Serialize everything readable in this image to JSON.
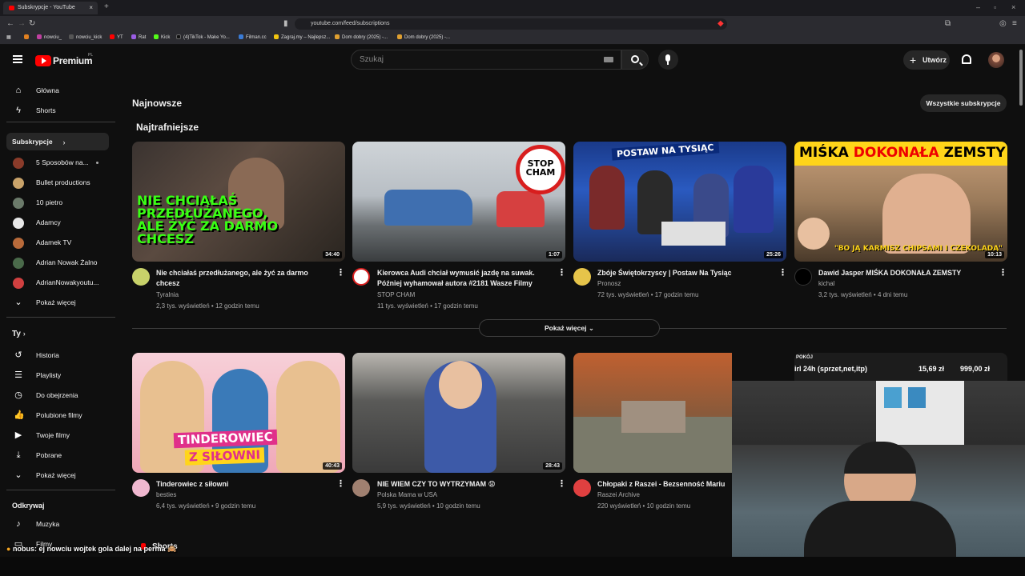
{
  "browser": {
    "tab_title": "Subskrypcje - YouTube",
    "url": "youtube.com/feed/subscriptions",
    "bookmarks": [
      "nowciu_",
      "nowciu_kick",
      "YT",
      "Rat",
      "Kick",
      "(4)TikTok - Make Yo...",
      "Filman.cc",
      "Zagraj.my – Najlepsz...",
      "Dom dobry (2025) -...",
      "Dom dobry (2025) -..."
    ]
  },
  "masthead": {
    "logo": "Premium",
    "logo_region": "PL",
    "search_placeholder": "Szukaj",
    "create_label": "Utwórz"
  },
  "sidebar": {
    "main": [
      {
        "label": "Główna",
        "icon": "home-icon"
      },
      {
        "label": "Shorts",
        "icon": "shorts-icon"
      }
    ],
    "subscriptions_header": "Subskrypcje",
    "subscriptions": [
      {
        "label": "5 Sposobów na...",
        "color": "#8a3b2a",
        "new": true
      },
      {
        "label": "Bullet productions",
        "color": "#c9a36a"
      },
      {
        "label": "10 pietro",
        "color": "#6b7a6a"
      },
      {
        "label": "Adamcy",
        "color": "#e8e8e8"
      },
      {
        "label": "Adamek TV",
        "color": "#b86a3a"
      },
      {
        "label": "Adrian Nowak Żalno",
        "color": "#4a6a4a"
      },
      {
        "label": "AdrianNowakyoutu...",
        "color": "#d04040"
      }
    ],
    "show_more": "Pokaż więcej",
    "you_header": "Ty",
    "you_items": [
      {
        "label": "Historia",
        "icon": "history-icon"
      },
      {
        "label": "Playlisty",
        "icon": "playlist-icon"
      },
      {
        "label": "Do obejrzenia",
        "icon": "watch-later-icon"
      },
      {
        "label": "Polubione filmy",
        "icon": "like-icon"
      },
      {
        "label": "Twoje filmy",
        "icon": "your-videos-icon"
      },
      {
        "label": "Pobrane",
        "icon": "download-icon"
      }
    ],
    "you_show_more": "Pokaż więcej",
    "explore_header": "Odkrywaj",
    "explore_items": [
      {
        "label": "Muzyka",
        "icon": "music-icon"
      },
      {
        "label": "Filmy",
        "icon": "movies-icon"
      }
    ]
  },
  "main": {
    "section_title": "Najnowsze",
    "all_subs_button": "Wszystkie subskrypcje",
    "shelf_title": "Najtrafniejsze",
    "show_more": "Pokaż więcej",
    "shorts_label": "Shorts",
    "row1": [
      {
        "title": "Nie chciałaś przedłużanego, ale żyć za darmo chcesz",
        "channel": "Tyralnia",
        "meta": "2,3 tys. wyświetleń • 12 godzin temu",
        "duration": "34:40",
        "thumb_text": "NIE CHCIAŁAŚ PRZEDŁUŻANEGO, ALE ŻYĆ ZA DARMO CHCESZ"
      },
      {
        "title": "Kierowca Audi chciał wymusić jazdę na suwak. Później wyhamował autora #2181 Wasze Filmy",
        "channel": "STOP CHAM",
        "meta": "11 tys. wyświetleń • 17 godzin temu",
        "duration": "1:07",
        "thumb_text": "STOP CHAM"
      },
      {
        "title": "Zbóje Świętokrzyscy | Postaw Na Tysiąc",
        "channel": "Pronosz",
        "meta": "72 tys. wyświetleń • 17 godzin temu",
        "duration": "25:26",
        "thumb_text": "POSTAW NA TYSIĄC"
      },
      {
        "title": "Dawid Jasper MIŚKA DOKONAŁA ZEMSTY",
        "channel": "kichal",
        "meta": "3,2 tys. wyświetleń • 4 dni temu",
        "duration": "10:13",
        "thumb_text_a": "MIŚKA",
        "thumb_text_b": "DOKONAŁA",
        "thumb_text_c": "ZEMSTY",
        "thumb_caption": "\"BO JĄ KARMISZ CHIPSAMI I CZEKOLADĄ\""
      }
    ],
    "row2": [
      {
        "title": "Tinderowiec z siłowni",
        "channel": "besties",
        "meta": "6,4 tys. wyświetleń • 9 godzin temu",
        "duration": "40:43",
        "thumb_text_a": "TINDEROWIEC",
        "thumb_text_b": "Z SIŁOWNI"
      },
      {
        "title": "NIE WIEM CZY TO WYTRZYMAM 😧",
        "channel": "Polska Mama w USA",
        "meta": "5,9 tys. wyświetleń • 10 godzin temu",
        "duration": "28:43"
      },
      {
        "title": "Chłopaki z Raszei - Bezsenność Mariu",
        "channel": "Raszei Archive",
        "meta": "220 wyświetleń • 10 godzin temu",
        "duration": ""
      }
    ]
  },
  "overlay": {
    "stream_top": "POKÓJ",
    "stream_text": "irl 24h (sprzet,net,itp)",
    "stream_amount1": "15,69 zł",
    "stream_amount2": "999,00 zł",
    "chat_user": "nobus",
    "chat_message": ": ej nowciu wojtek gola dalej na perma 🙈"
  },
  "colors": {
    "accent": "#ff0000",
    "bg": "#0f0f0f",
    "chip": "#272727"
  }
}
